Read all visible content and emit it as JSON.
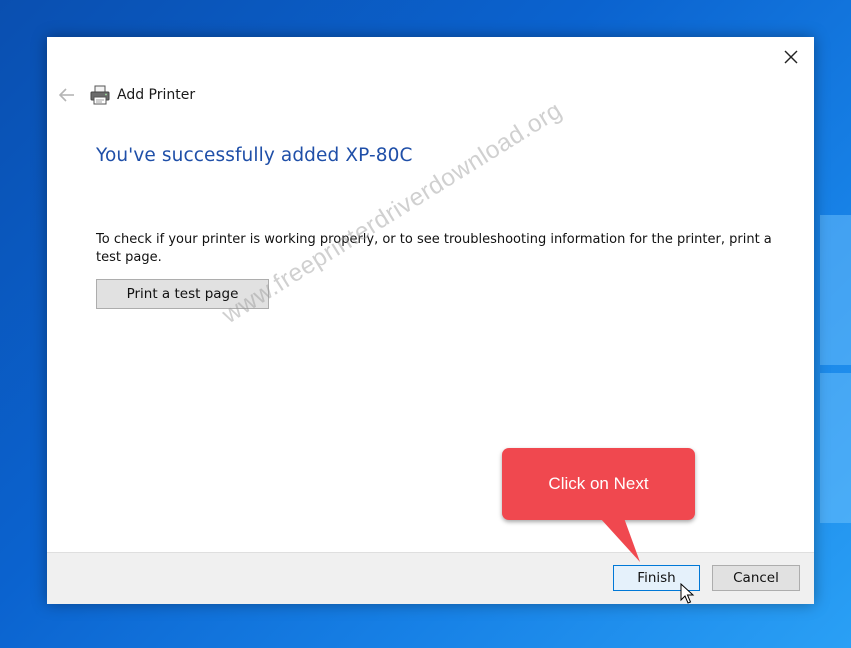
{
  "dialog": {
    "header_title": "Add Printer",
    "success_title": "You've successfully added XP-80C",
    "info_text": "To check if your printer is working properly, or to see troubleshooting information for the printer, print a test page.",
    "print_test_label": "Print a test page",
    "finish_label": "Finish",
    "cancel_label": "Cancel"
  },
  "watermark": "www.freeprinterdriverdownload.org",
  "callout": {
    "text": "Click on Next"
  },
  "icons": {
    "close": "close-icon",
    "back": "back-arrow-icon",
    "printer": "printer-icon",
    "cursor": "mouse-cursor-icon"
  },
  "colors": {
    "title_blue": "#1f4fa8",
    "callout_red": "#f0484f",
    "focus_blue": "#0078d7"
  }
}
